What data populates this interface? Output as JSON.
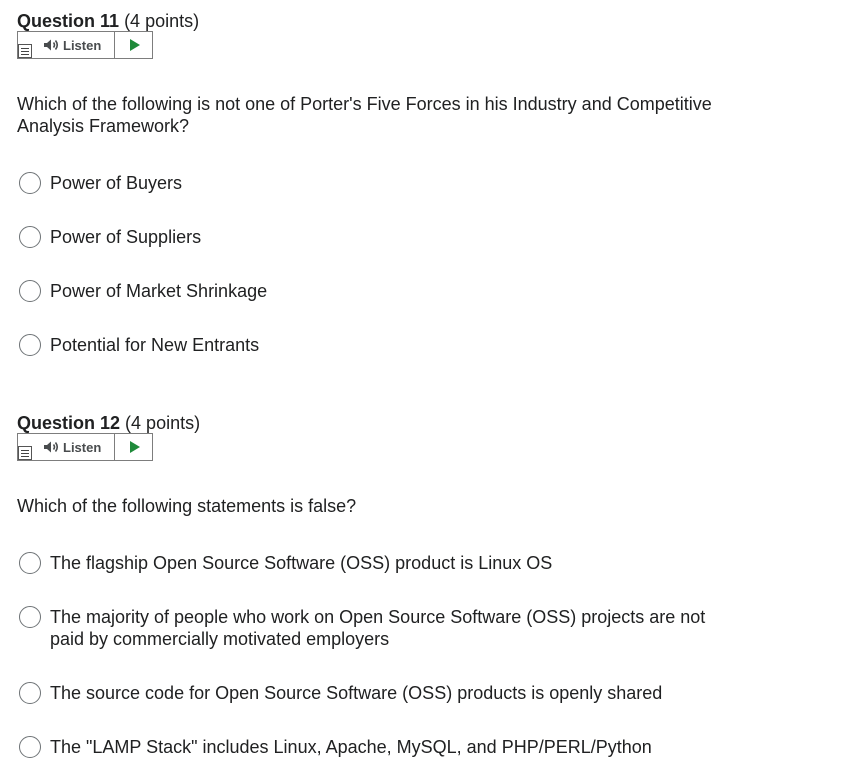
{
  "questions": [
    {
      "title": "Question 11",
      "points": "(4 points)",
      "listen_label": "Listen",
      "text": "Which of the following is not one of Porter's Five Forces in his Industry and Competitive Analysis Framework?",
      "options": [
        "Power of Buyers",
        "Power of Suppliers",
        "Power of Market Shrinkage",
        "Potential for New Entrants"
      ]
    },
    {
      "title": "Question 12",
      "points": "(4 points)",
      "listen_label": "Listen",
      "text": "Which of the following statements is false?",
      "options": [
        "The flagship Open Source Software (OSS) product is Linux OS",
        "The majority of people who work on Open Source Software (OSS) projects are not paid by commercially motivated employers",
        "The source code for Open Source Software (OSS) products is openly shared",
        "The \"LAMP Stack\" includes Linux, Apache, MySQL, and PHP/PERL/Python"
      ]
    }
  ],
  "icons": {
    "speaker": "speaker-icon",
    "play": "play-icon",
    "document": "document-icon"
  },
  "colors": {
    "text": "#202122",
    "play_green": "#1f8a3a",
    "border": "#7d7d7d"
  }
}
